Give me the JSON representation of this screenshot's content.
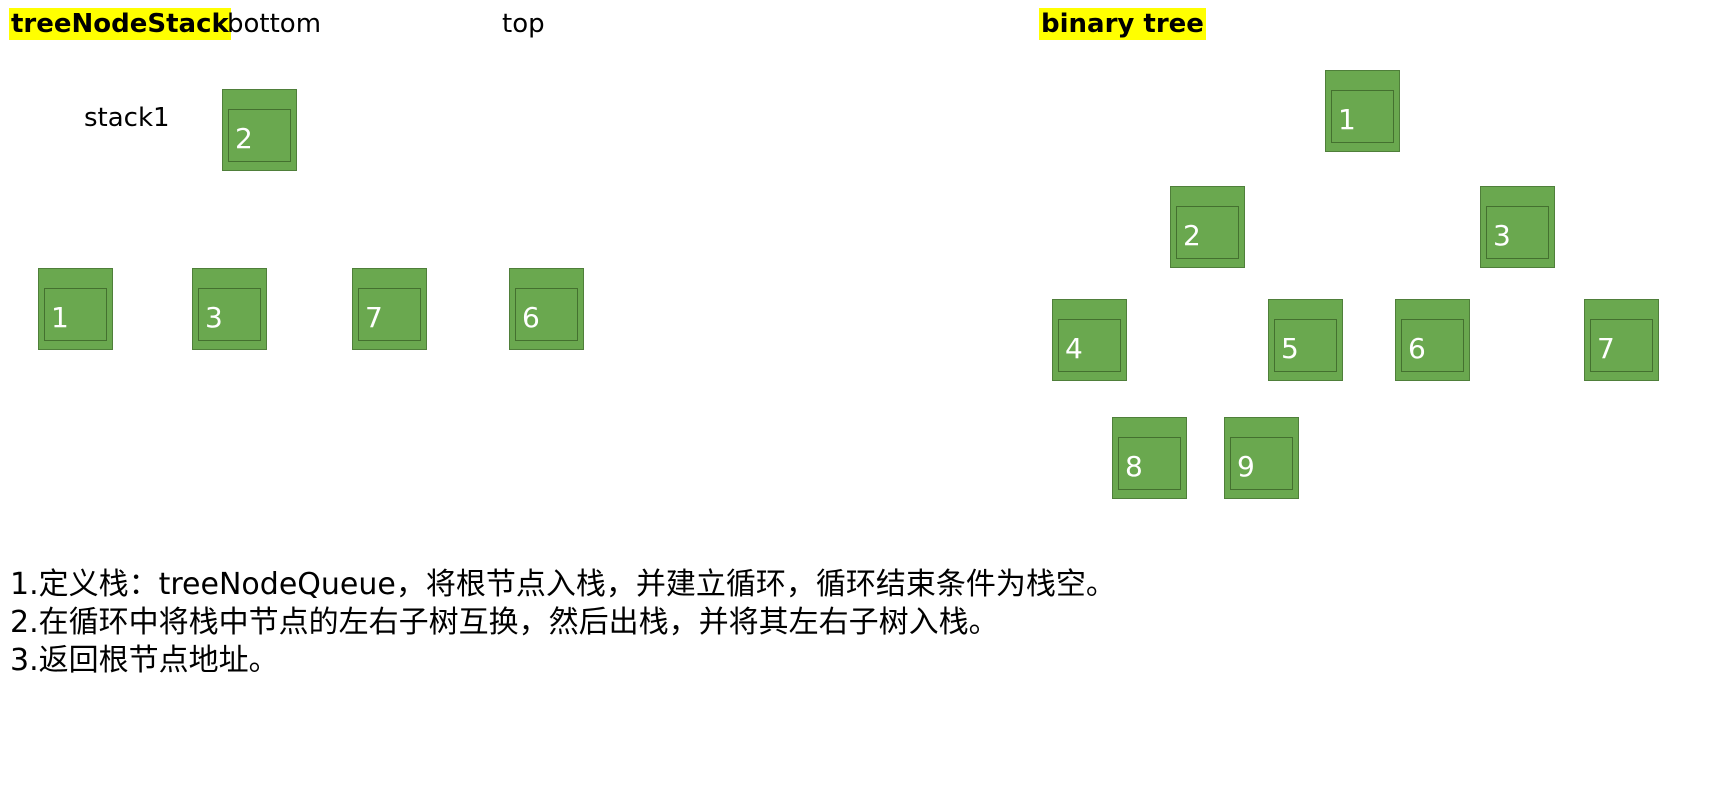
{
  "stack_panel": {
    "title": "treeNodeStack",
    "bottom_label": "bottom",
    "top_label": "top",
    "stack1_label": "stack1",
    "stack1_nodes": [
      "2"
    ],
    "nodes": [
      "1",
      "3",
      "7",
      "6"
    ]
  },
  "tree_panel": {
    "title": "binary tree",
    "nodes": [
      "1",
      "2",
      "3",
      "4",
      "5",
      "6",
      "7",
      "8",
      "9"
    ]
  },
  "steps": [
    "1.定义栈：treeNodeQueue，将根节点入栈，并建立循环，循环结束条件为栈空。",
    "2.在循环中将栈中节点的左右子树互换，然后出栈，并将其左右子树入栈。",
    "3.返回根节点地址。"
  ],
  "colors": {
    "highlight": "#ffff00",
    "node_fill": "#6aa84f",
    "node_text": "#ffffff"
  }
}
